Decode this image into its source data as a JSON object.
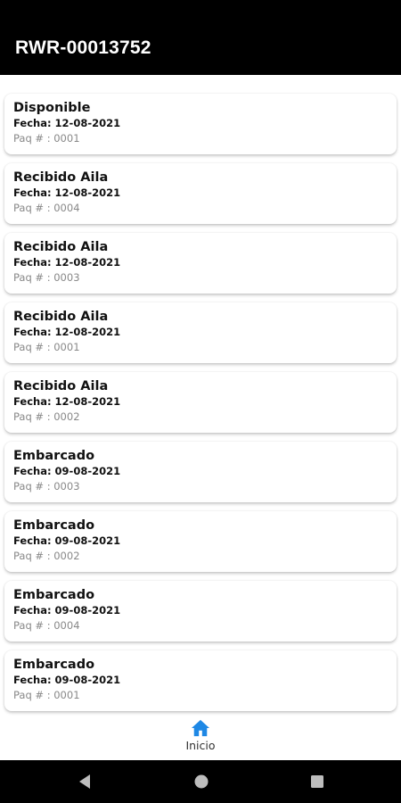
{
  "header": {
    "title": "RWR-00013752"
  },
  "items": [
    {
      "status": "Disponible",
      "date": "Fecha: 12-08-2021",
      "paq": "Paq # : 0001"
    },
    {
      "status": "Recibido Aila",
      "date": "Fecha: 12-08-2021",
      "paq": "Paq # : 0004"
    },
    {
      "status": "Recibido Aila",
      "date": "Fecha: 12-08-2021",
      "paq": "Paq # : 0003"
    },
    {
      "status": "Recibido Aila",
      "date": "Fecha: 12-08-2021",
      "paq": "Paq # : 0001"
    },
    {
      "status": "Recibido Aila",
      "date": "Fecha: 12-08-2021",
      "paq": "Paq # : 0002"
    },
    {
      "status": "Embarcado",
      "date": "Fecha: 09-08-2021",
      "paq": "Paq # : 0003"
    },
    {
      "status": "Embarcado",
      "date": "Fecha: 09-08-2021",
      "paq": "Paq # : 0002"
    },
    {
      "status": "Embarcado",
      "date": "Fecha: 09-08-2021",
      "paq": "Paq # : 0004"
    },
    {
      "status": "Embarcado",
      "date": "Fecha: 09-08-2021",
      "paq": "Paq # : 0001"
    }
  ],
  "bottom_nav": {
    "home_label": "Inicio",
    "home_icon": "home-icon",
    "accent": "#1e88e5"
  },
  "system_nav": {
    "back_icon": "back-icon",
    "home_icon": "circle-home-icon",
    "recents_icon": "recents-icon"
  }
}
